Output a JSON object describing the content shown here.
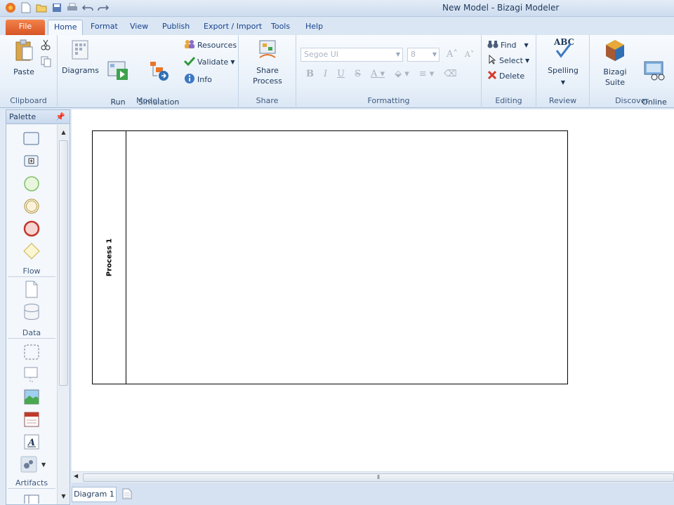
{
  "window": {
    "title": "New Model - Bizagi Modeler"
  },
  "qat": {
    "icons": [
      "bizagi-logo-icon",
      "new-icon",
      "open-icon",
      "save-icon",
      "print-icon",
      "undo-icon",
      "redo-icon"
    ]
  },
  "tabs": [
    {
      "label": "File"
    },
    {
      "label": "Home"
    },
    {
      "label": "Format"
    },
    {
      "label": "View"
    },
    {
      "label": "Publish"
    },
    {
      "label": "Export / Import"
    },
    {
      "label": "Tools"
    },
    {
      "label": "Help"
    }
  ],
  "ribbon": {
    "clipboard": {
      "paste": "Paste",
      "label": "Clipboard"
    },
    "model": {
      "diagrams": "Diagrams",
      "run_workflow": "Run\nWorkflow",
      "simulation_view": "Simulation\nView",
      "resources": "Resources",
      "validate": "Validate",
      "info": "Info",
      "label": "Model"
    },
    "share": {
      "share_process": "Share Process",
      "label": "Share"
    },
    "formatting": {
      "font": "Segoe UI",
      "size": "8",
      "label": "Formatting"
    },
    "editing": {
      "find": "Find",
      "select": "Select",
      "delete": "Delete",
      "label": "Editing"
    },
    "review": {
      "spelling": "Spelling",
      "label": "Review"
    },
    "discover": {
      "bizagi_suite": "Bizagi Suite",
      "online_courses": "Online\nCourses",
      "label": "Discover"
    }
  },
  "palette": {
    "title": "Palette",
    "sections": {
      "flow": "Flow",
      "data": "Data",
      "artifacts": "Artifacts"
    }
  },
  "diagram": {
    "pool_label": "Process 1"
  },
  "doc_tabs": {
    "active": "Diagram 1"
  },
  "colors": {
    "file_tab": "#d75526",
    "start_event": "#7cc26b",
    "end_event": "#c0392b",
    "intermediate_event": "#d9c27a",
    "gateway": "#e8d77a"
  }
}
